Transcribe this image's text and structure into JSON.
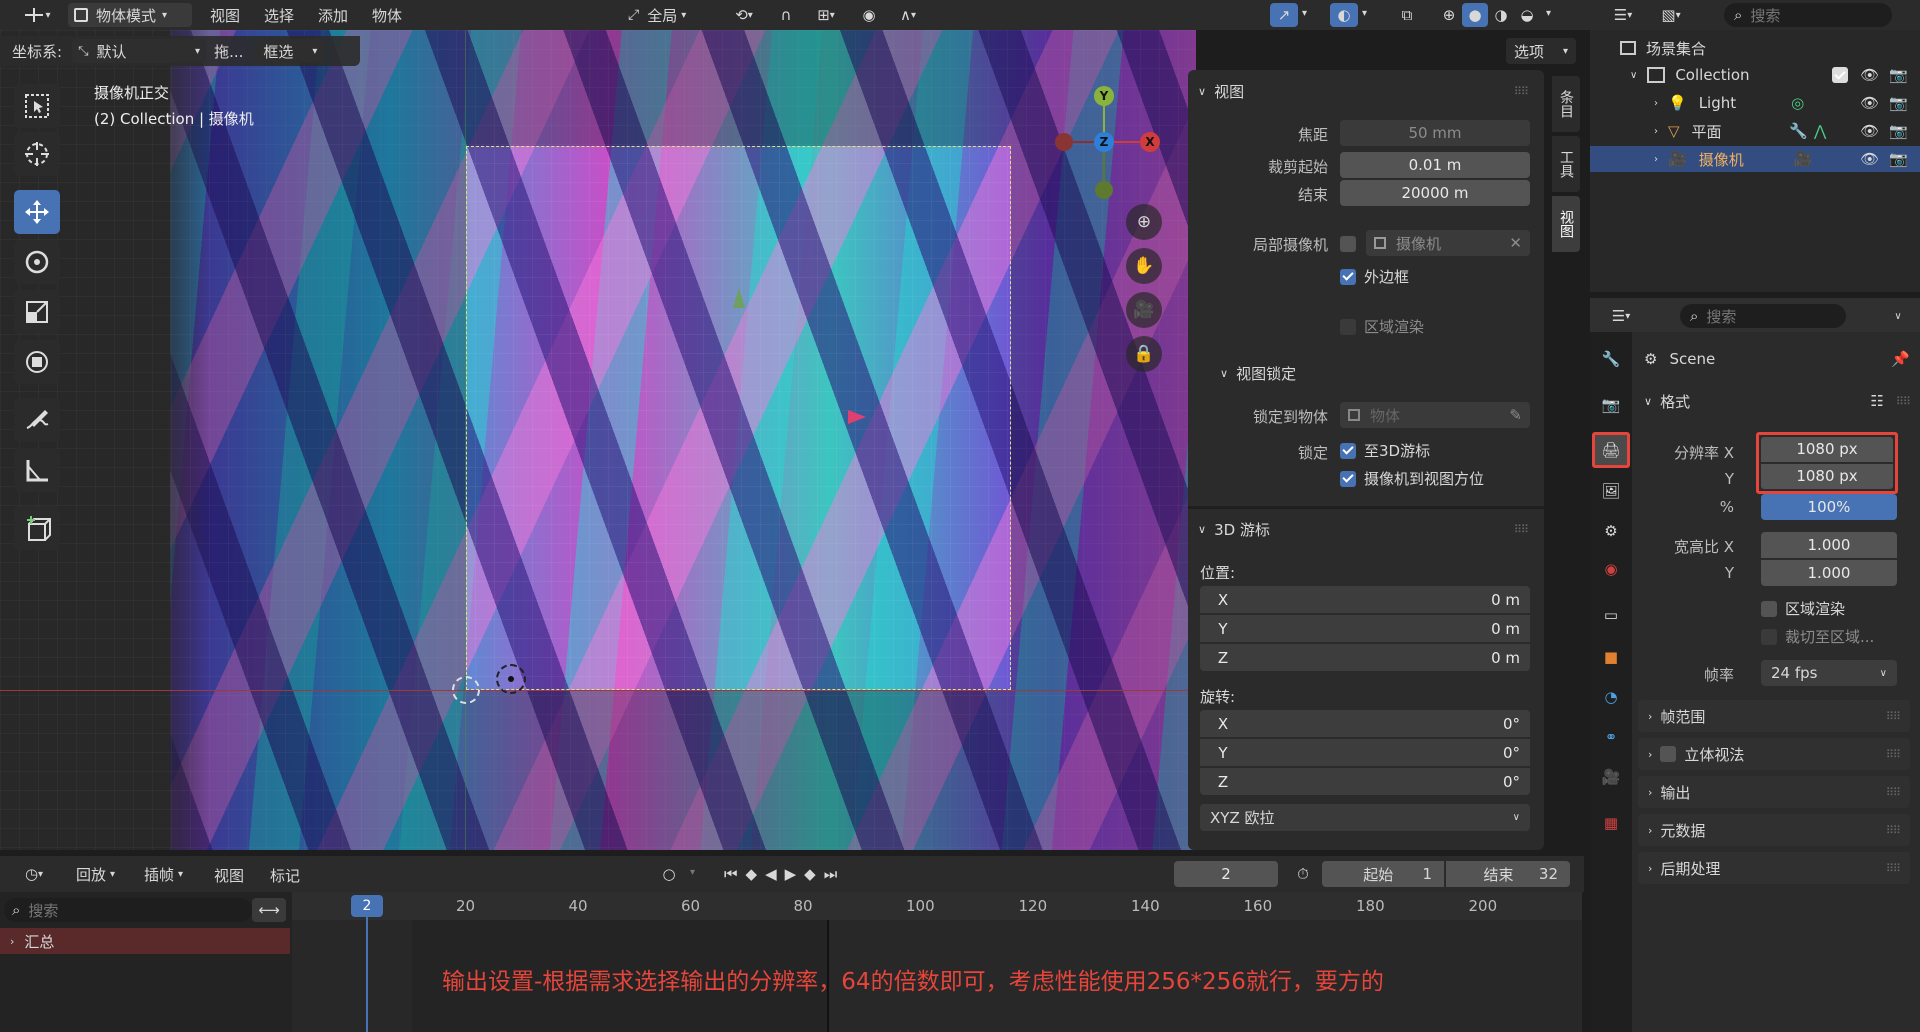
{
  "top_header": {
    "mode_label": "物体模式",
    "menu": [
      "视图",
      "选择",
      "添加",
      "物体"
    ],
    "transform_orientation": "全局"
  },
  "tool_header": {
    "coord_label": "坐标系:",
    "coord_value": "默认",
    "drag_label": "拖...",
    "drag_value": "框选",
    "options_label": "选项"
  },
  "viewport": {
    "overlay_title": "摄像机正交",
    "overlay_subtitle": "(2) Collection | 摄像机",
    "gizmo": {
      "x": "X",
      "y": "Y",
      "z": "Z"
    }
  },
  "side_tabs": [
    "条目",
    "工具",
    "视图"
  ],
  "n_panel": {
    "view_section": {
      "title": "视图",
      "focal_label": "焦距",
      "focal_value": "50 mm",
      "clip_start_label": "裁剪起始",
      "clip_start_value": "0.01 m",
      "clip_end_label": "结束",
      "clip_end_value": "20000 m",
      "local_camera_label": "局部摄像机",
      "local_camera_value": "摄像机",
      "border_label": "外边框",
      "border_checked": true,
      "region_render_label": "区域渲染",
      "region_render_checked": false
    },
    "view_lock": {
      "title": "视图锁定",
      "lock_to_object_label": "锁定到物体",
      "lock_to_object_placeholder": "物体",
      "lock_label": "锁定",
      "to_3d_cursor_label": "至3D游标",
      "to_3d_cursor_checked": true,
      "camera_to_view_label": "摄像机到视图方位",
      "camera_to_view_checked": true
    },
    "cursor_section": {
      "title": "3D 游标",
      "location_label": "位置:",
      "location": [
        {
          "axis": "X",
          "value": "0 m"
        },
        {
          "axis": "Y",
          "value": "0 m"
        },
        {
          "axis": "Z",
          "value": "0 m"
        }
      ],
      "rotation_label": "旋转:",
      "rotation": [
        {
          "axis": "X",
          "value": "0°"
        },
        {
          "axis": "Y",
          "value": "0°"
        },
        {
          "axis": "Z",
          "value": "0°"
        }
      ],
      "rotation_mode": "XYZ 欧拉"
    }
  },
  "outliner": {
    "search_placeholder": "搜索",
    "scene_collection": "场景集合",
    "items": [
      {
        "name": "Collection",
        "selected": false
      },
      {
        "name": "Light",
        "selected": false
      },
      {
        "name": "平面",
        "selected": false
      },
      {
        "name": "摄像机",
        "selected": true
      }
    ]
  },
  "properties": {
    "search_placeholder": "搜索",
    "scene_name": "Scene",
    "format_section": "格式",
    "res_x_label": "分辨率 X",
    "res_x_value": "1080 px",
    "res_y_label": "Y",
    "res_y_value": "1080 px",
    "res_pct_label": "%",
    "res_pct_value": "100%",
    "res_pct_fraction": 1.0,
    "aspect_x_label": "宽高比 X",
    "aspect_x_value": "1.000",
    "aspect_y_label": "Y",
    "aspect_y_value": "1.000",
    "region_render_label": "区域渲染",
    "crop_label": "裁切至区域...",
    "fps_label": "帧率",
    "fps_value": "24 fps",
    "collapsed_sections": [
      "帧范围",
      "立体视法",
      "输出",
      "元数据",
      "后期处理"
    ],
    "highlight_color": "#e5453b"
  },
  "timeline": {
    "menu": [
      "回放",
      "插帧",
      "视图",
      "标记"
    ],
    "current_frame": "2",
    "start_label": "起始",
    "start_value": "1",
    "end_label": "结束",
    "end_value": "32",
    "search_placeholder": "搜索",
    "summary_label": "汇总",
    "ruler": [
      "20",
      "40",
      "60",
      "80",
      "100",
      "120",
      "140",
      "160",
      "180",
      "200"
    ],
    "playhead_label": "2"
  },
  "annotation": {
    "text": "输出设置-根据需求选择输出的分辨率，64的倍数即可，考虑性能使用256*256就行，要方的",
    "color": "#e5453b"
  }
}
